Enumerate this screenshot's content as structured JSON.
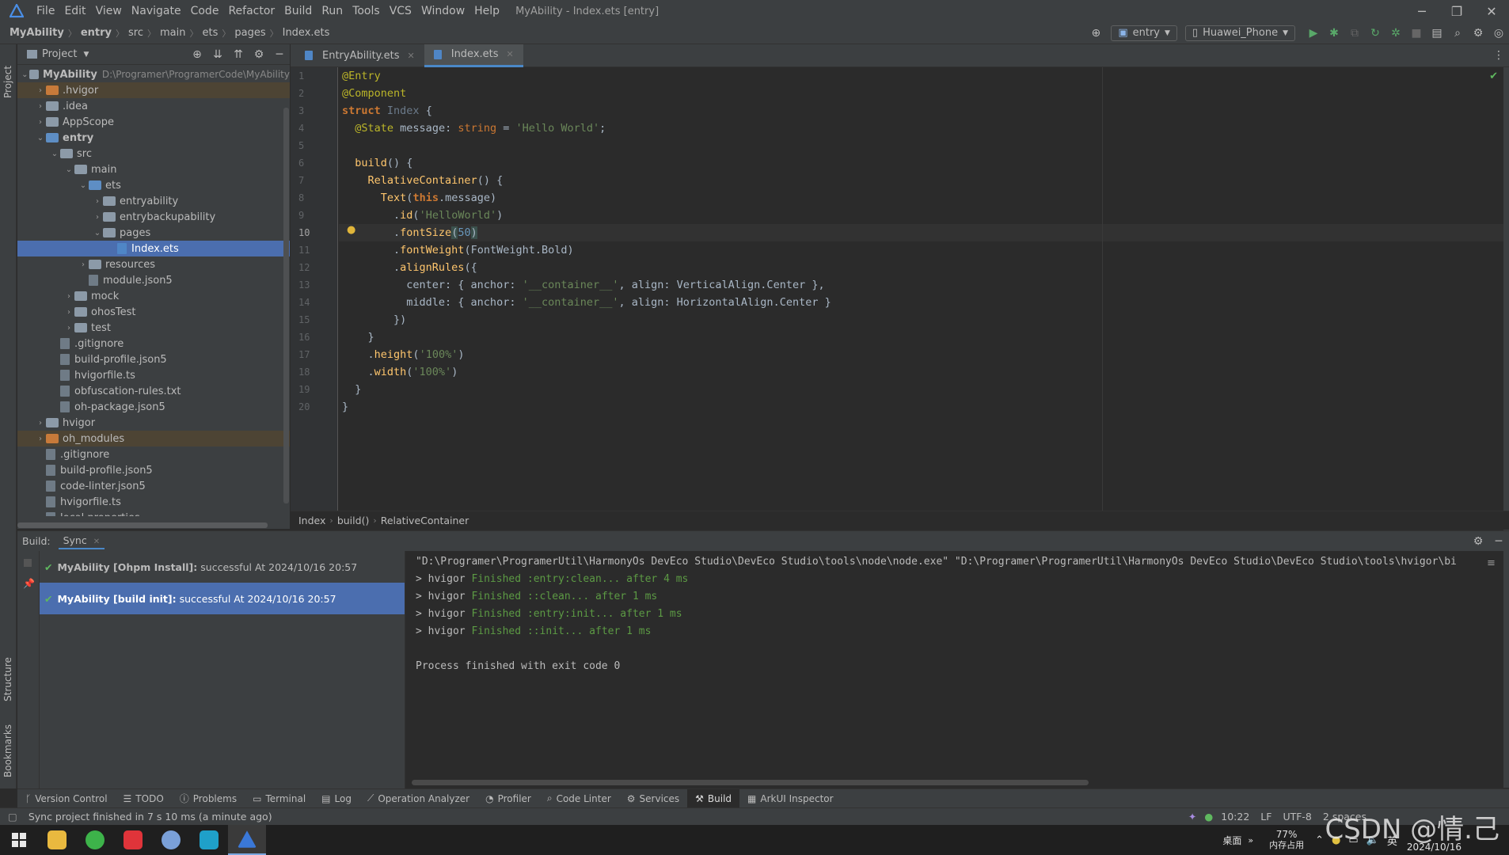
{
  "app": {
    "menus": [
      "File",
      "Edit",
      "View",
      "Navigate",
      "Code",
      "Refactor",
      "Build",
      "Run",
      "Tools",
      "VCS",
      "Window",
      "Help"
    ],
    "window_title": "MyAbility - Index.ets [entry]"
  },
  "navbar": {
    "breadcrumbs": [
      "MyAbility",
      "entry",
      "src",
      "main",
      "ets",
      "pages",
      "Index.ets"
    ],
    "module_select": "entry",
    "device_select": "Huawei_Phone"
  },
  "left_stripe": {
    "project": "Project",
    "structure": "Structure",
    "bookmarks": "Bookmarks"
  },
  "project": {
    "title": "Project",
    "tree": [
      {
        "label": "MyAbility",
        "extra": "D:\\Programer\\ProgramerCode\\MyAbility",
        "depth": 0,
        "kind": "folder",
        "open": true,
        "bold": true
      },
      {
        "label": ".hvigor",
        "depth": 1,
        "kind": "folder-orange",
        "open": false,
        "hl": "orange"
      },
      {
        "label": ".idea",
        "depth": 1,
        "kind": "folder",
        "open": false
      },
      {
        "label": "AppScope",
        "depth": 1,
        "kind": "folder",
        "open": false
      },
      {
        "label": "entry",
        "depth": 1,
        "kind": "folder-blue",
        "open": true,
        "bold": true
      },
      {
        "label": "src",
        "depth": 2,
        "kind": "folder",
        "open": true
      },
      {
        "label": "main",
        "depth": 3,
        "kind": "folder",
        "open": true
      },
      {
        "label": "ets",
        "depth": 4,
        "kind": "folder-blue",
        "open": true
      },
      {
        "label": "entryability",
        "depth": 5,
        "kind": "folder",
        "open": false
      },
      {
        "label": "entrybackupability",
        "depth": 5,
        "kind": "folder",
        "open": false
      },
      {
        "label": "pages",
        "depth": 5,
        "kind": "folder",
        "open": true
      },
      {
        "label": "Index.ets",
        "depth": 6,
        "kind": "ets",
        "sel": true
      },
      {
        "label": "resources",
        "depth": 4,
        "kind": "folder",
        "open": false
      },
      {
        "label": "module.json5",
        "depth": 4,
        "kind": "file"
      },
      {
        "label": "mock",
        "depth": 3,
        "kind": "folder",
        "open": false
      },
      {
        "label": "ohosTest",
        "depth": 3,
        "kind": "folder",
        "open": false
      },
      {
        "label": "test",
        "depth": 3,
        "kind": "folder",
        "open": false
      },
      {
        "label": ".gitignore",
        "depth": 2,
        "kind": "file"
      },
      {
        "label": "build-profile.json5",
        "depth": 2,
        "kind": "file"
      },
      {
        "label": "hvigorfile.ts",
        "depth": 2,
        "kind": "file"
      },
      {
        "label": "obfuscation-rules.txt",
        "depth": 2,
        "kind": "file"
      },
      {
        "label": "oh-package.json5",
        "depth": 2,
        "kind": "file"
      },
      {
        "label": "hvigor",
        "depth": 1,
        "kind": "folder",
        "open": false
      },
      {
        "label": "oh_modules",
        "depth": 1,
        "kind": "folder-orange",
        "open": false,
        "hl": "orange"
      },
      {
        "label": ".gitignore",
        "depth": 1,
        "kind": "file"
      },
      {
        "label": "build-profile.json5",
        "depth": 1,
        "kind": "file"
      },
      {
        "label": "code-linter.json5",
        "depth": 1,
        "kind": "file"
      },
      {
        "label": "hvigorfile.ts",
        "depth": 1,
        "kind": "file"
      },
      {
        "label": "local.properties",
        "depth": 1,
        "kind": "file"
      }
    ]
  },
  "tabs": [
    {
      "label": "EntryAbility.ets",
      "active": false
    },
    {
      "label": "Index.ets",
      "active": true
    }
  ],
  "editor": {
    "line_numbers": [
      "1",
      "2",
      "3",
      "4",
      "5",
      "6",
      "7",
      "8",
      "9",
      "10",
      "11",
      "12",
      "13",
      "14",
      "15",
      "16",
      "17",
      "18",
      "19",
      "20"
    ],
    "current_line": 10,
    "breadcrumb": [
      "Index",
      "build()",
      "RelativeContainer"
    ]
  },
  "build": {
    "label": "Build:",
    "tab": "Sync",
    "items": [
      {
        "title": "MyAbility [Ohpm Install]:",
        "status": "successful At 2024/10/16 20:57",
        "sel": false
      },
      {
        "title": "MyAbility [build init]:",
        "status": "successful At 2024/10/16 20:57",
        "sel": true
      }
    ],
    "console": [
      {
        "prefix": "\"D:\\Programer\\ProgramerUtil\\HarmonyOs DevEco Studio\\DevEco Studio\\tools\\node\\node.exe\" \"D:\\Programer\\ProgramerUtil\\HarmonyOs DevEco Studio\\DevEco Studio\\tools\\hvigor\\bi",
        "green": ""
      },
      {
        "prefix": "> hvigor ",
        "green": "Finished :entry:clean... after 4 ms"
      },
      {
        "prefix": "> hvigor ",
        "green": "Finished ::clean... after 1 ms"
      },
      {
        "prefix": "> hvigor ",
        "green": "Finished :entry:init... after 1 ms"
      },
      {
        "prefix": "> hvigor ",
        "green": "Finished ::init... after 1 ms"
      },
      {
        "prefix": "",
        "green": ""
      },
      {
        "prefix": "Process finished with exit code 0",
        "green": ""
      }
    ]
  },
  "bottom_tools": [
    {
      "label": "Version Control",
      "icon": "branch-icon",
      "active": false
    },
    {
      "label": "TODO",
      "icon": "list-icon",
      "active": false
    },
    {
      "label": "Problems",
      "icon": "info-icon",
      "active": false
    },
    {
      "label": "Terminal",
      "icon": "terminal-icon",
      "active": false
    },
    {
      "label": "Log",
      "icon": "log-icon",
      "active": false
    },
    {
      "label": "Operation Analyzer",
      "icon": "chart-icon",
      "active": false
    },
    {
      "label": "Profiler",
      "icon": "profiler-icon",
      "active": false
    },
    {
      "label": "Code Linter",
      "icon": "search-icon",
      "active": false
    },
    {
      "label": "Services",
      "icon": "services-icon",
      "active": false
    },
    {
      "label": "Build",
      "icon": "hammer-icon",
      "active": true
    },
    {
      "label": "ArkUI Inspector",
      "icon": "grid-icon",
      "active": false
    }
  ],
  "status": {
    "message": "Sync project finished in 7 s 10 ms (a minute ago)",
    "time": "10:22",
    "line_sep": "LF",
    "encoding": "UTF-8",
    "indent": "2 spaces"
  },
  "taskbar": {
    "desktop": "桌面",
    "memory_pct": "77%",
    "memory_label": "内存占用",
    "ime": "英",
    "date": "2024/10/16"
  },
  "watermark": "CSDN @情.己"
}
